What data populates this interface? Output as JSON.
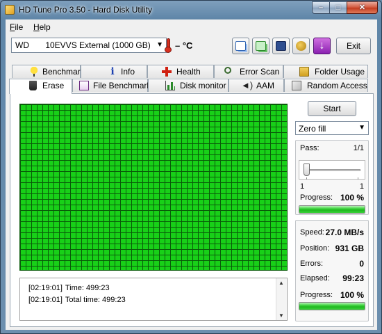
{
  "window": {
    "title": "HD Tune Pro 3.50 - Hard Disk Utility",
    "minimize": "–",
    "maximize": "□",
    "close": "✕"
  },
  "menu": [
    {
      "label": "File",
      "underline": "F",
      "rest": "ile"
    },
    {
      "label": "Help",
      "underline": "H",
      "rest": "elp"
    }
  ],
  "toolbar": {
    "drive": "WD       10EVVS External (1000 GB)",
    "temperature": "– °C",
    "exit_label": "Exit",
    "icons": [
      "copy-text-icon",
      "copy-screenshot-icon",
      "save-icon",
      "options-icon",
      "download-icon"
    ]
  },
  "tabs": {
    "row1": [
      "Benchmark",
      "Info",
      "Health",
      "Error Scan",
      "Folder Usage"
    ],
    "row2": [
      "Erase",
      "File Benchmark",
      "Disk monitor",
      "AAM",
      "Random Access"
    ],
    "active": "Erase"
  },
  "erase": {
    "start_label": "Start",
    "mode": "Zero fill",
    "pass_label": "Pass:",
    "pass_value": "1/1",
    "slider_min": "1",
    "slider_max": "1",
    "slider_position": 0.0,
    "progress_label": "Progress:",
    "progress_value": "100 %",
    "progress_fraction": 1.0,
    "speed_label": "Speed:",
    "speed_value": "27.0 MB/s",
    "position_label": "Position:",
    "position_value": "931 GB",
    "errors_label": "Errors:",
    "errors_value": "0",
    "elapsed_label": "Elapsed:",
    "elapsed_value": "99:23",
    "progress2_label": "Progress:",
    "progress2_value": "100 %",
    "progress2_fraction": 1.0,
    "block_status_color": "#18d018"
  },
  "log": [
    {
      "time": "[02:19:01]",
      "text": "Time: 499:23"
    },
    {
      "time": "[02:19:01]",
      "text": "Total time: 499:23"
    }
  ]
}
